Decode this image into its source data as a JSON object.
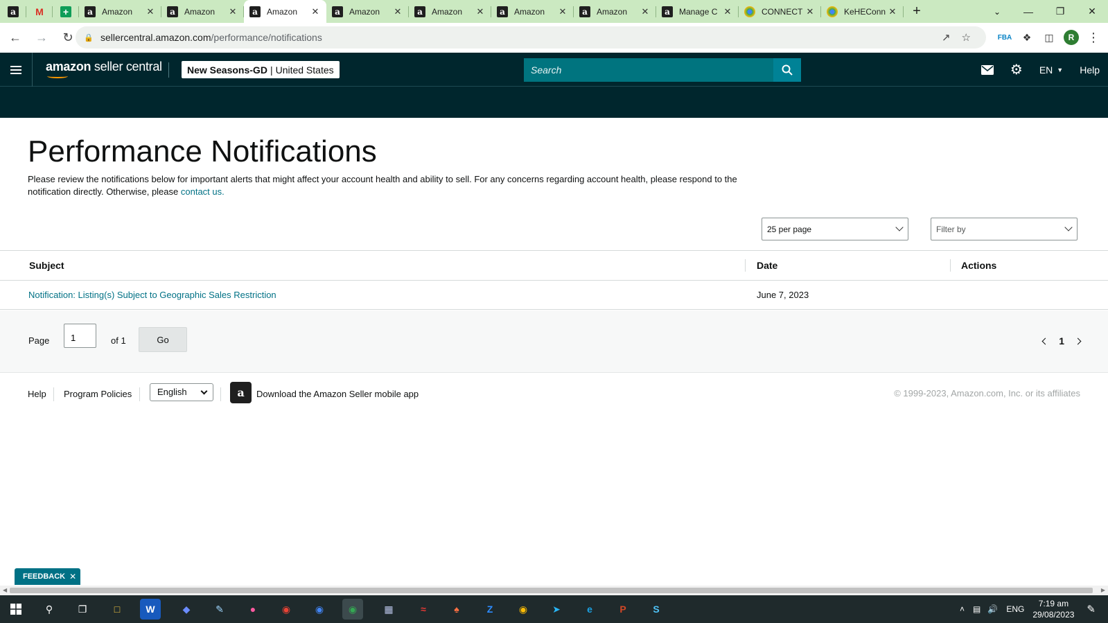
{
  "browser": {
    "tabs": [
      {
        "type": "pinned",
        "favicon": "amazon-favicon",
        "title": ""
      },
      {
        "type": "pinned",
        "favicon": "gmail-favicon",
        "title": ""
      },
      {
        "type": "pinned",
        "favicon": "sheets-favicon",
        "title": ""
      },
      {
        "type": "normal",
        "favicon": "amazon-favicon",
        "title": "Amazon"
      },
      {
        "type": "normal",
        "favicon": "amazon-favicon",
        "title": "Amazon"
      },
      {
        "type": "normal",
        "favicon": "amazon-favicon",
        "title": "Amazon",
        "active": true
      },
      {
        "type": "normal",
        "favicon": "amazon-favicon",
        "title": "Amazon"
      },
      {
        "type": "normal",
        "favicon": "amazon-favicon",
        "title": "Amazon"
      },
      {
        "type": "normal",
        "favicon": "amazon-favicon",
        "title": "Amazon"
      },
      {
        "type": "normal",
        "favicon": "amazon-favicon",
        "title": "Amazon"
      },
      {
        "type": "normal",
        "favicon": "amazon-favicon",
        "title": "Manage C"
      },
      {
        "type": "normal",
        "favicon": "chrome-favicon",
        "title": "CONNECT"
      },
      {
        "type": "normal",
        "favicon": "chrome-favicon",
        "title": "KeHEConn"
      }
    ],
    "url_host": "sellercentral.amazon.com",
    "url_path": "/performance/notifications",
    "profile_initial": "R"
  },
  "header": {
    "logo_prefix": "amazon",
    "logo_suffix": " seller central",
    "account_name": "New Seasons-GD",
    "account_sep": "|",
    "account_region": "United States",
    "search_placeholder": "Search",
    "language": "EN",
    "help": "Help"
  },
  "page": {
    "title": "Performance Notifications",
    "intro_text": "Please review the notifications below for important alerts that might affect your account health and ability to sell. For any concerns regarding account health, please respond to the notification directly. Otherwise, please ",
    "intro_link": "contact us."
  },
  "filters": {
    "per_page": "25 per page",
    "filter_by": "Filter by"
  },
  "table": {
    "columns": {
      "subject": "Subject",
      "date": "Date",
      "actions": "Actions"
    },
    "rows": [
      {
        "subject": "Notification: Listing(s) Subject to Geographic Sales Restriction",
        "date": "June 7, 2023",
        "actions": ""
      }
    ]
  },
  "pager": {
    "page_label": "Page",
    "page_value": "1",
    "of_label": "of 1",
    "go_label": "Go",
    "current_page": "1"
  },
  "footer": {
    "help": "Help",
    "program_policies": "Program Policies",
    "language": "English",
    "app_text": "Download the Amazon Seller mobile app",
    "copyright": "© 1999-2023, Amazon.com, Inc. or its affiliates"
  },
  "feedback": {
    "label": "FEEDBACK"
  },
  "taskbar": {
    "language": "ENG",
    "time": "7:19 am",
    "date": "29/08/2023"
  },
  "colors": {
    "header_bg": "#00262d",
    "search_bg": "#00747f",
    "link": "#007185",
    "tabstrip": "#cbe9c1"
  }
}
